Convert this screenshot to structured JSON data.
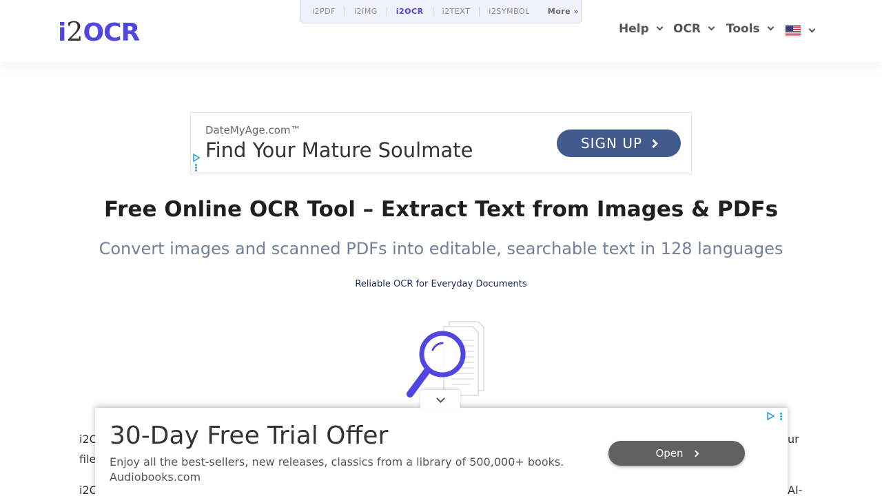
{
  "header": {
    "logo": {
      "i": "i",
      "two": "2",
      "ocr": "OCR"
    },
    "sites": [
      "i2PDF",
      "i2IMG",
      "i2OCR",
      "i2TEXT",
      "i2SYMBOL"
    ],
    "sites_active": "i2OCR",
    "more_label": "More »",
    "nav": {
      "help": "Help",
      "ocr": "OCR",
      "tools": "Tools"
    },
    "language_icon": "us-flag-icon"
  },
  "ad_banner": {
    "sponsor": "DateMyAge.com™",
    "headline": "Find Your Mature Soulmate",
    "cta": "SIGN UP",
    "cta_color": "#435a8f"
  },
  "hero": {
    "title": "Free Online OCR Tool – Extract Text from Images & PDFs",
    "subtitle": "Convert images and scanned PDFs into editable, searchable text in 128 languages",
    "tagline": "Reliable OCR for Everyday Documents"
  },
  "body": {
    "line1_left": "i2O",
    "line1_right": "ur",
    "line2_left": "file",
    "line3_left": "i2O",
    "line3_right": "AI-"
  },
  "sticky_ad": {
    "headline": "30-Day Free Trial Offer",
    "description": "Enjoy all the best-sellers, new releases, classics from a library of 500,000+ books.",
    "source": "Audiobooks.com",
    "cta": "Open"
  },
  "colors": {
    "brand": "#5146e1",
    "subtitle": "#71819b"
  }
}
